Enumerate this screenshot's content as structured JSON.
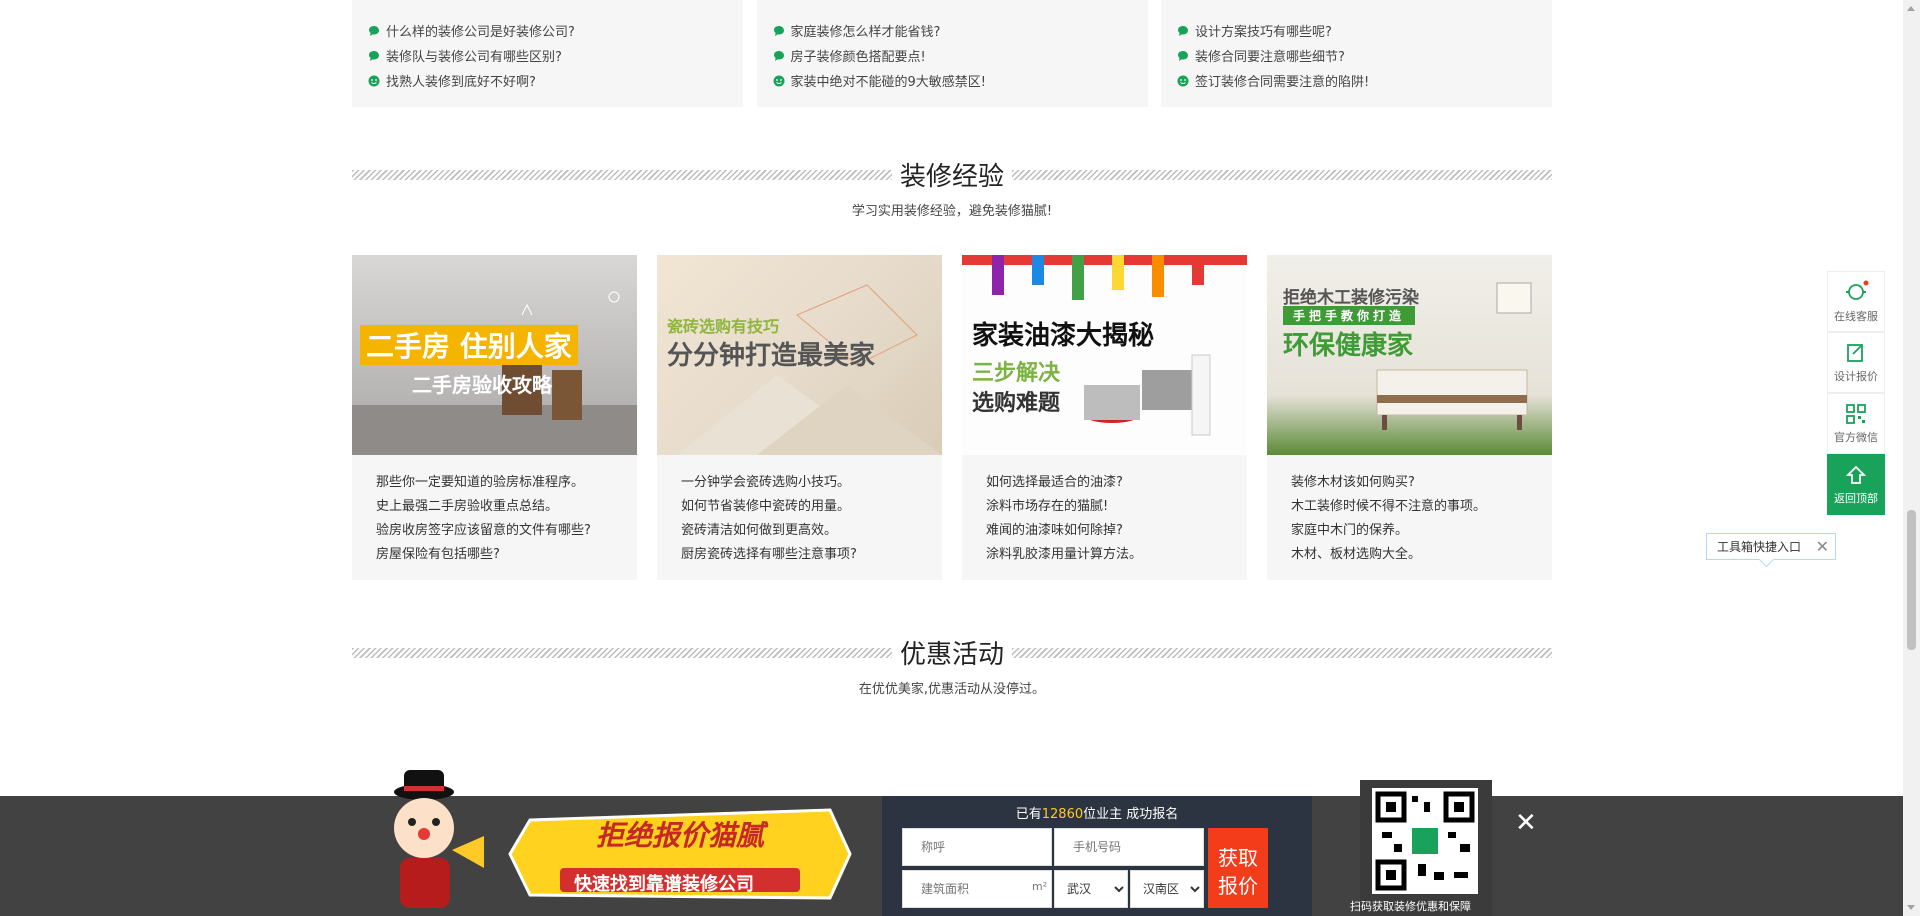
{
  "faq": {
    "columns": [
      [
        "什么样的装修公司是好装修公司?",
        "装修队与装修公司有哪些区别?",
        "找熟人装修到底好不好啊?"
      ],
      [
        "家庭装修怎么样才能省钱?",
        "房子装修颜色搭配要点!",
        "家装中绝对不能碰的9大敏感禁区!"
      ],
      [
        "设计方案技巧有哪些呢?",
        "装修合同要注意哪些细节?",
        "签订装修合同需要注意的陷阱!"
      ]
    ]
  },
  "experience": {
    "title": "装修经验",
    "subtitle": "学习实用装修经验，避免装修猫腻!",
    "cards": [
      {
        "banner_main": "二手房 住别人家",
        "banner_sub": "二手房验收攻略",
        "items": [
          "那些你一定要知道的验房标准程序。",
          "史上最强二手房验收重点总结。",
          "验房收房签字应该留意的文件有哪些?",
          "房屋保险有包括哪些?"
        ]
      },
      {
        "banner_top": "瓷砖选购有技巧",
        "banner_main": "分分钟打造最美家",
        "items": [
          "一分钟学会瓷砖选购小技巧。",
          "如何节省装修中瓷砖的用量。",
          "瓷砖清洁如何做到更高效。",
          "厨房瓷砖选择有哪些注意事项?"
        ]
      },
      {
        "banner_main": "家装油漆大揭秘",
        "banner_sub1": "三步解决",
        "banner_sub2": "选购难题",
        "items": [
          "如何选择最适合的油漆?",
          "涂料市场存在的猫腻!",
          "难闻的油漆味如何除掉?",
          "涂料乳胶漆用量计算方法。"
        ]
      },
      {
        "banner_top": "拒绝木工装修污染",
        "banner_mid": "手把手教你打造",
        "banner_main": "环保健康家",
        "items": [
          "装修木材该如何购买?",
          "木工装修时候不得不注意的事项。",
          "家庭中木门的保养。",
          "木材、板材选购大全。"
        ]
      }
    ]
  },
  "promotion": {
    "title": "优惠活动",
    "subtitle": "在优优美家,优惠活动从没停过。"
  },
  "sidebar": {
    "items": [
      {
        "label": "在线客服",
        "icon": "headset-icon"
      },
      {
        "label": "设计报价",
        "icon": "edit-icon"
      },
      {
        "label": "官方微信",
        "icon": "qrcode-icon"
      },
      {
        "label": "返回顶部",
        "icon": "home-arrow-icon"
      }
    ],
    "tip": "工具箱快捷入口"
  },
  "bottom_bar": {
    "count_prefix": "已有",
    "count_value": "12860",
    "count_suffix": "位业主 成功报名",
    "name_placeholder": "称呼",
    "phone_placeholder": "手机号码",
    "area_placeholder": "建筑面积",
    "area_unit": "m²",
    "city": "武汉",
    "district": "汉南区",
    "submit_line1": "获取",
    "submit_line2": "报价",
    "banner_main": "拒绝报价猫腻",
    "banner_sub": "快速找到靠谱装修公司",
    "qr_caption": "扫码获取装修优惠和保障",
    "close": "✕"
  },
  "colors": {
    "green": "#19a35a",
    "orange": "#f33d1a",
    "yellow": "#ffca28"
  }
}
